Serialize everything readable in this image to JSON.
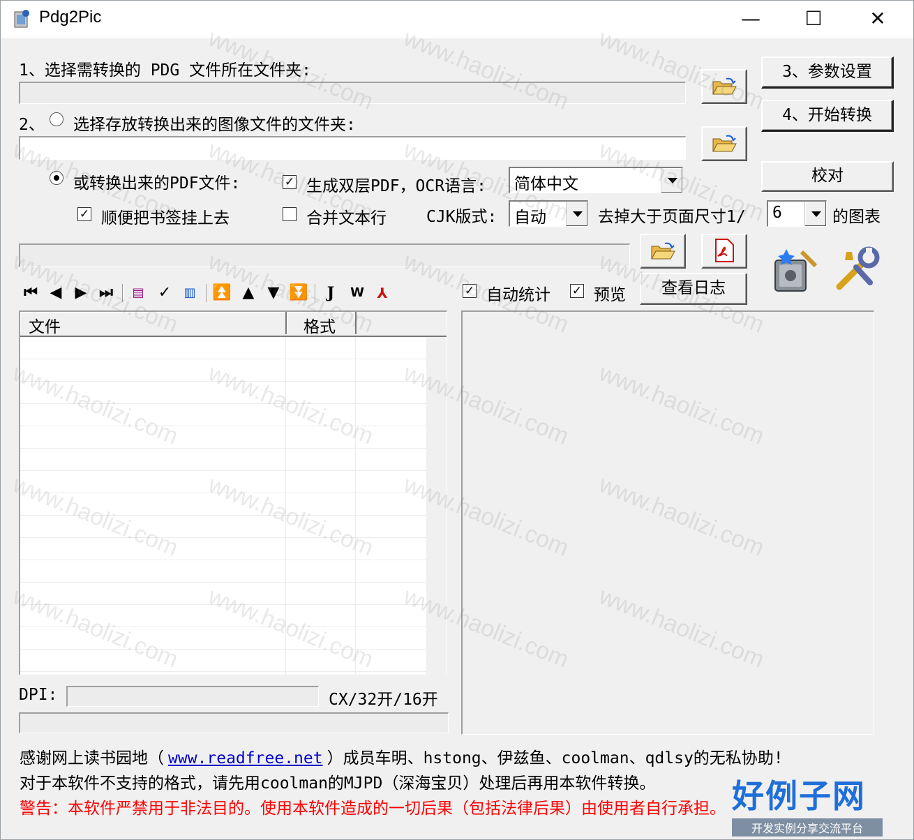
{
  "window": {
    "title": "Pdg2Pic",
    "minimize_glyph": "—",
    "maximize_glyph": "☐",
    "close_glyph": "✕"
  },
  "step1": {
    "label": "1、选择需转换的 PDG 文件所在文件夹:",
    "path": ""
  },
  "step2": {
    "prefix": "2、",
    "label": "选择存放转换出来的图像文件的文件夹:",
    "path": ""
  },
  "pdf_option": {
    "label": "或转换出来的PDF文件:",
    "dual_layer_label": "生成双层PDF，OCR语言:",
    "ocr_language": "简体中文",
    "bookmark_label": "顺便把书签挂上去",
    "merge_lines_label": "合并文本行",
    "cjk_label": "CJK版式:",
    "cjk_value": "自动",
    "remove_label": "去掉大于页面尺寸1/",
    "remove_value": "6",
    "remove_suffix": "的图表"
  },
  "buttons": {
    "settings": "3、参数设置",
    "start": "4、开始转换",
    "verify": "校对",
    "view_log": "查看日志"
  },
  "options": {
    "auto_stats": "自动统计",
    "preview": "预览"
  },
  "file_list": {
    "columns": [
      "文件",
      "格式"
    ],
    "rows": []
  },
  "dpi": {
    "label": "DPI:",
    "value": "",
    "format_text": "CX/32开/16开"
  },
  "footer": {
    "thanks_prefix": "感谢网上读书园地（",
    "link": "www.readfree.net",
    "thanks_suffix": "）成员车明、hstong、伊兹鱼、coolman、qdlsy的无私协助!",
    "note": "对于本软件不支持的格式，请先用coolman的MJPD（深海宝贝）处理后再用本软件转换。",
    "warning": "警告：本软件严禁用于非法目的。使用本软件造成的一切后果（包括法律后果）由使用者自行承担。"
  },
  "watermark": {
    "text": "www.haolizi.com",
    "logo_main": "好例子网",
    "logo_sub": "开发实例分享交流平台"
  },
  "colors": {
    "warning": "#ff0000",
    "link": "#0000cc",
    "logo": "#1e6fd9"
  }
}
